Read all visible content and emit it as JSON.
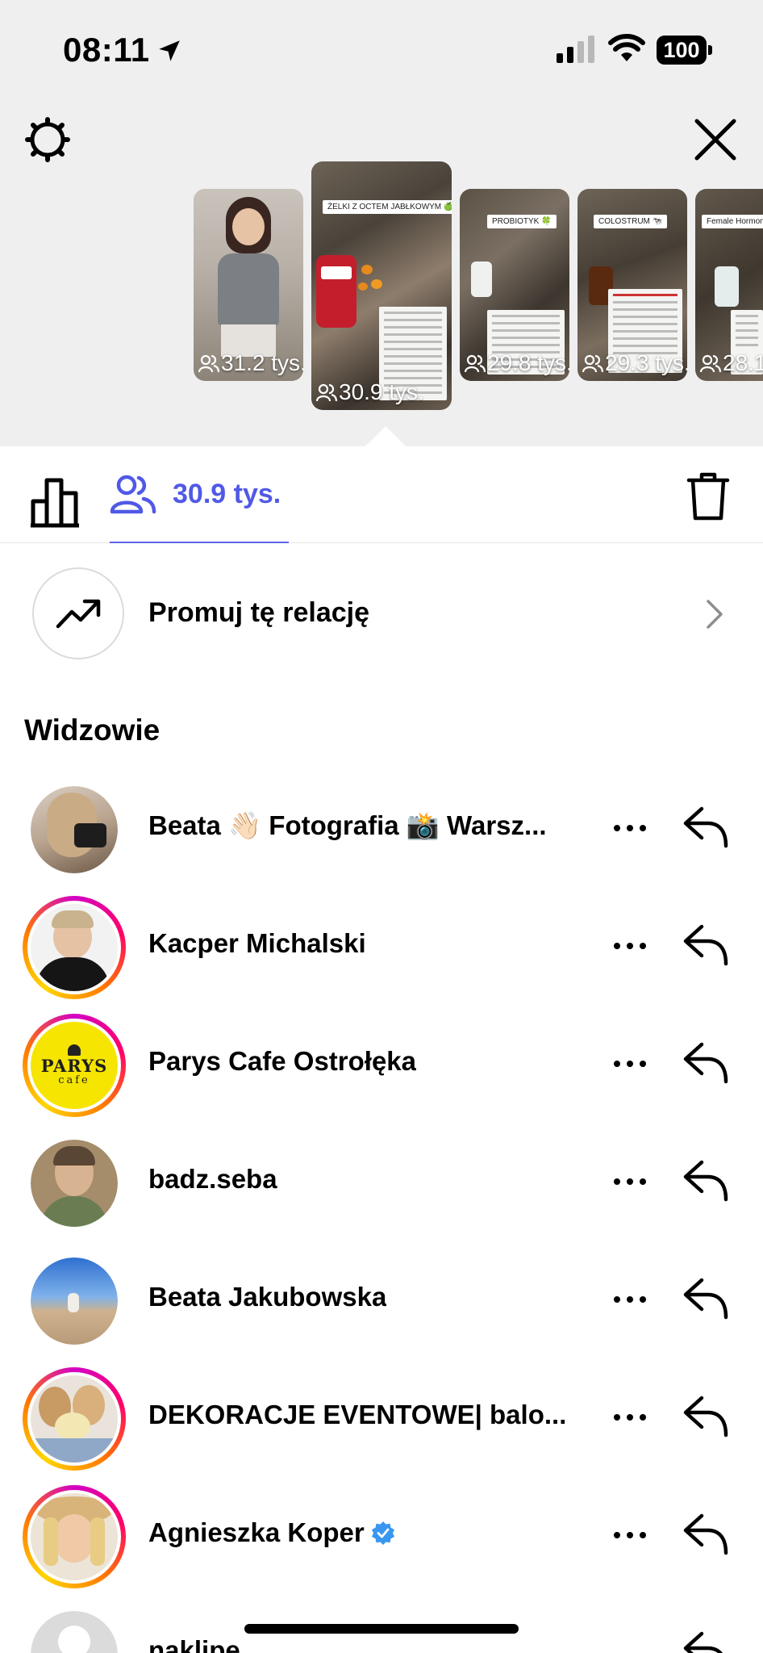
{
  "status_bar": {
    "time": "08:11",
    "battery": "100"
  },
  "stories": [
    {
      "count": "31.2 tys.",
      "caption": ""
    },
    {
      "count": "30.9 tys.",
      "caption": "ŻELKI Z OCTEM JABŁKOWYM 🍏",
      "selected": true
    },
    {
      "count": "29.8 tys.",
      "caption": "PROBIOTYK 🍀"
    },
    {
      "count": "29.3 tys.",
      "caption": "COLOSTRUM 🐄"
    },
    {
      "count": "28.1",
      "caption": "Female Hormones S"
    }
  ],
  "tabs": {
    "viewers_count": "30.9 tys."
  },
  "promote": {
    "label": "Promuj tę relację"
  },
  "section_title": "Widzowie",
  "viewers": [
    {
      "name": "Beata 👋🏻 Fotografia 📸 Warsz...",
      "ring": false,
      "verified": false
    },
    {
      "name": "Kacper Michalski",
      "ring": true,
      "verified": false
    },
    {
      "name": "Parys Cafe Ostrołęka",
      "ring": true,
      "verified": false,
      "avatar_text": "PARYS",
      "avatar_sub": "cafe"
    },
    {
      "name": "badz.seba",
      "ring": false,
      "verified": false
    },
    {
      "name": "Beata Jakubowska",
      "ring": false,
      "verified": false
    },
    {
      "name": "DEKORACJE EVENTOWE| balo...",
      "ring": true,
      "verified": false
    },
    {
      "name": "Agnieszka Koper",
      "ring": true,
      "verified": true
    },
    {
      "name": "naklipe",
      "ring": false,
      "verified": false
    }
  ],
  "colors": {
    "accent": "#5059e6",
    "ring_start": "#d300c5",
    "ring_end": "#ffd600",
    "verified": "#3897f0"
  }
}
